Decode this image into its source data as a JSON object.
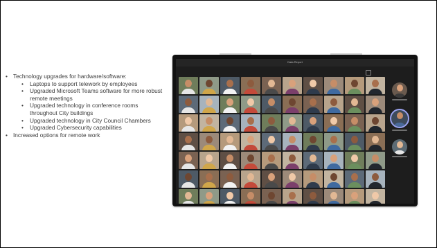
{
  "bullets": [
    {
      "text": "Technology upgrades for hardware/software:",
      "children": [
        "Laptops to support telework by employees",
        "Upgraded Microsoft Teams software for more robust remote meetings",
        "Upgraded technology in conference rooms throughout City buildings",
        "Upgraded technology in City Council Chambers",
        "Upgraded Cybersecurity capabilities"
      ]
    },
    {
      "text": "Increased options for remote work",
      "children": []
    }
  ],
  "meeting": {
    "window_title": "Data Report"
  },
  "colors": {
    "text": "#3b3b3b",
    "laptop_frame": "#111111",
    "screen_bg": "#1d1d1d",
    "active_ring": "#9ba3f0"
  }
}
